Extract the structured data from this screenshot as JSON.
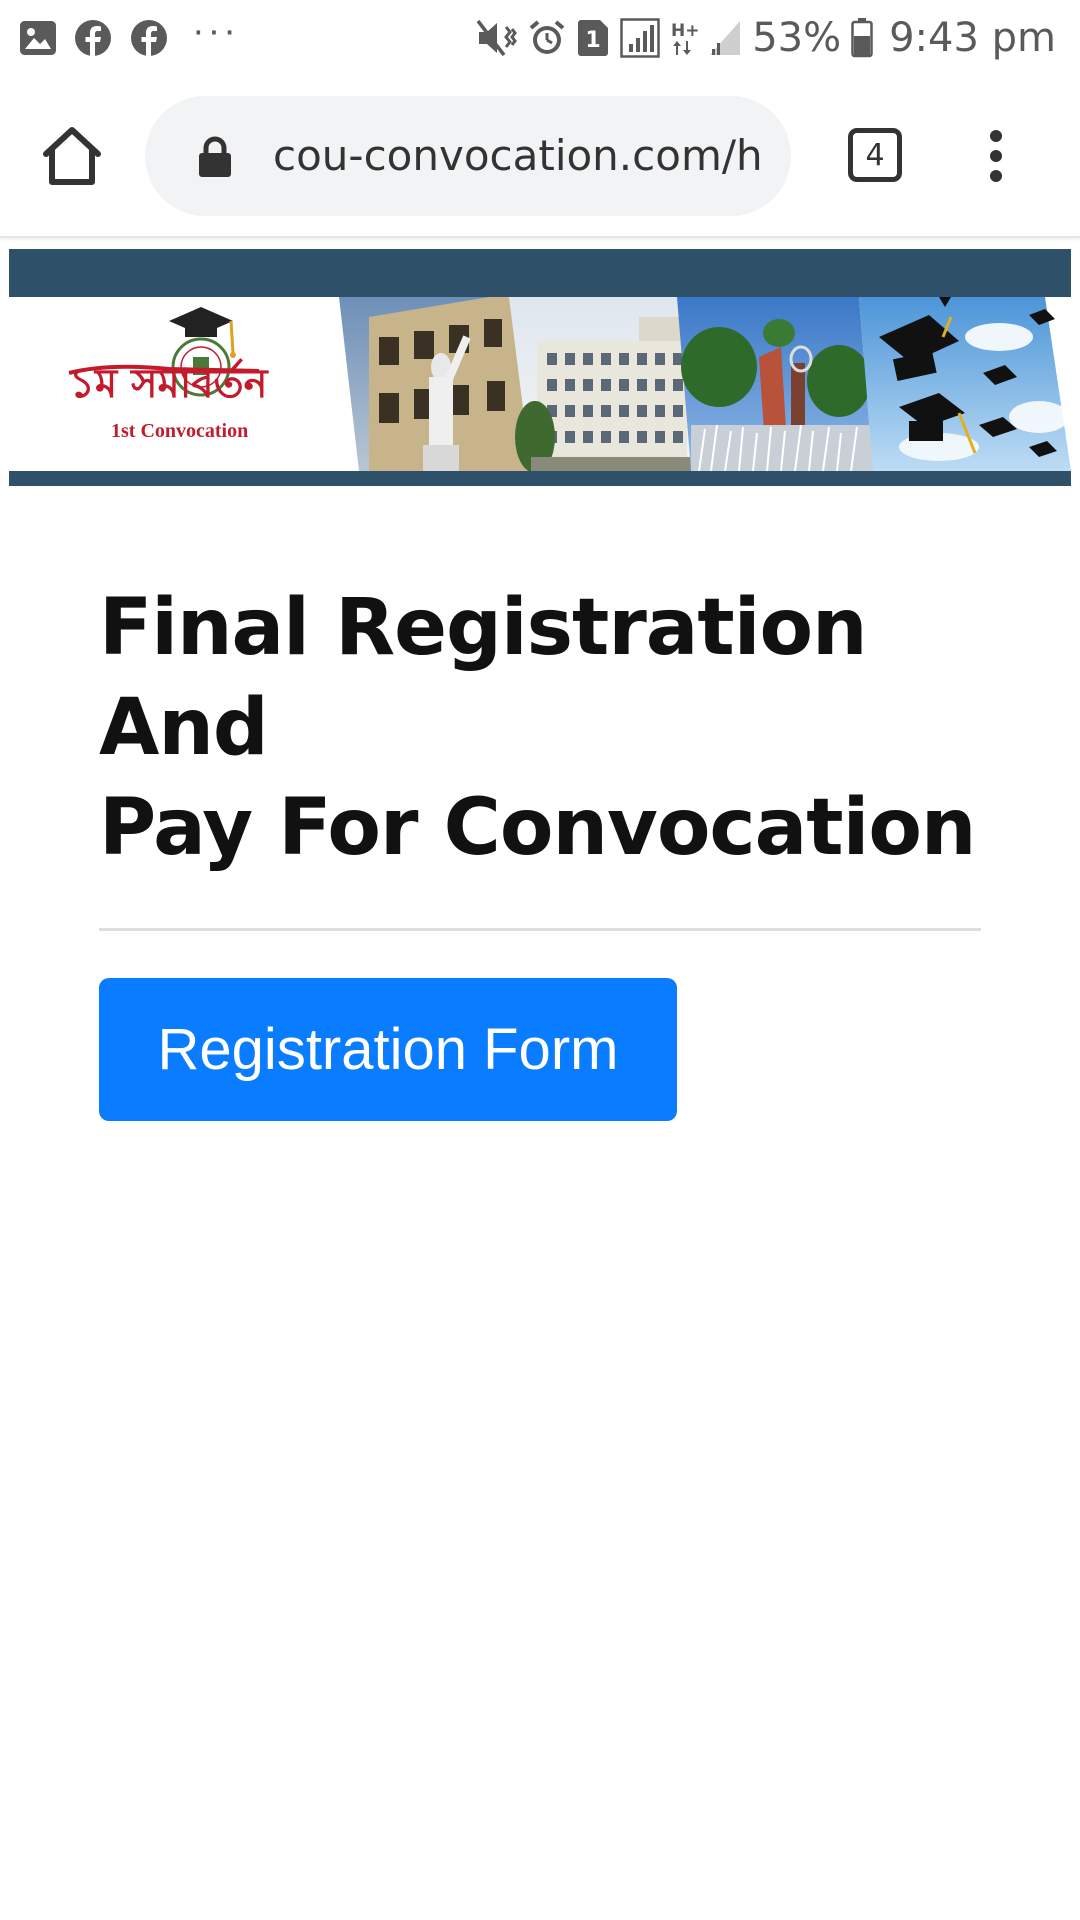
{
  "status_bar": {
    "left_icons": [
      "gallery-icon",
      "facebook-icon",
      "facebook-icon"
    ],
    "more_indicator": "···",
    "right_icons": [
      "vibrate-mute-icon",
      "alarm-icon",
      "sim-1-icon",
      "signal-boxed-icon",
      "network-hplus-icon",
      "signal-weak-icon",
      "battery-icon"
    ],
    "network_label": "H+",
    "sim_label": "1",
    "battery": "53%",
    "time": "9:43 pm"
  },
  "browser": {
    "url": "cou-convocation.com/h",
    "tab_count": "4",
    "icons": [
      "home-icon",
      "lock-icon",
      "tab-switcher-icon",
      "more-vert-icon"
    ]
  },
  "banner": {
    "logo_text_bengali": "১ম সমাবর্তন",
    "logo_text_english": "1st Convocation",
    "colors": {
      "frame": "#2e5069",
      "logo_red": "#c41b2c"
    }
  },
  "page": {
    "title_line1": "Final Registration And",
    "title_line2": "Pay For Convocation",
    "button_label": "Registration Form",
    "button_color": "#0a7cff"
  }
}
